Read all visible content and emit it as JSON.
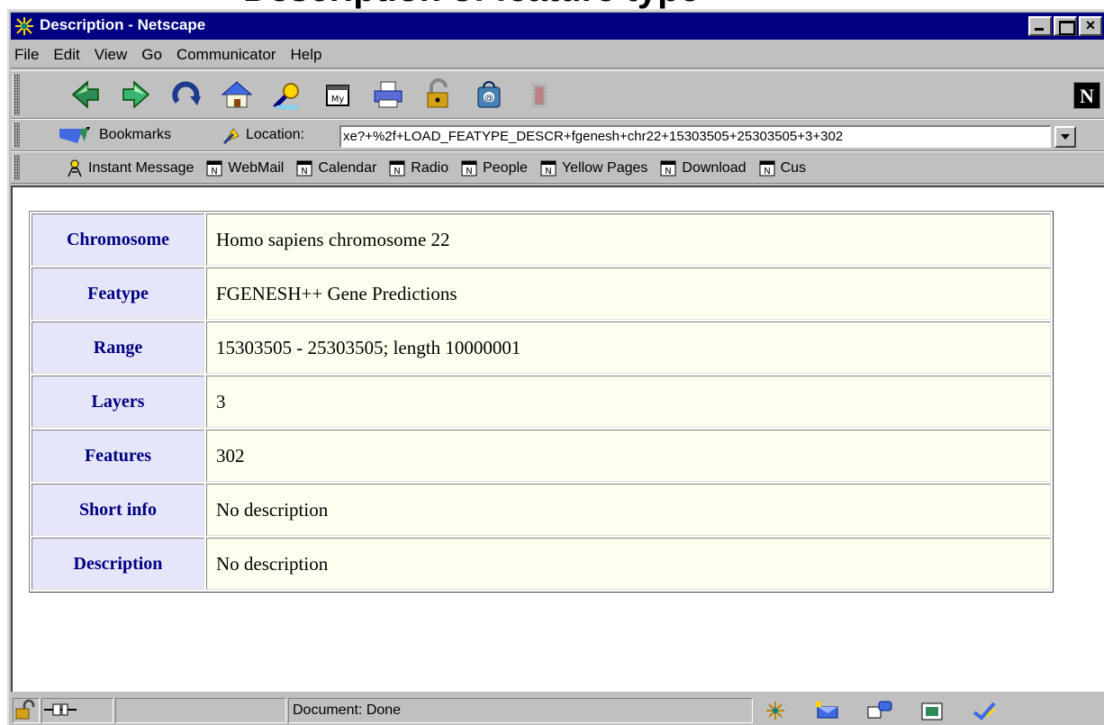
{
  "slide": {
    "heading_fragment": "Description of feature type"
  },
  "window": {
    "title": "Description - Netscape",
    "controls": {
      "minimize": "_",
      "maximize": "□",
      "close": "×"
    }
  },
  "menu": [
    "File",
    "Edit",
    "View",
    "Go",
    "Communicator",
    "Help"
  ],
  "navigation_icons": [
    "back-icon",
    "forward-icon",
    "reload-icon",
    "home-icon",
    "search-icon",
    "my-netscape-icon",
    "print-icon",
    "security-icon",
    "shop-icon",
    "stop-icon"
  ],
  "netscape_logo": "N",
  "location_bar": {
    "bookmarks_label": "Bookmarks",
    "location_label": "Location:",
    "url": "xe?+%2f+LOAD_FEATYPE_DESCR+fgenesh+chr22+15303505+25303505+3+302"
  },
  "personal_toolbar": [
    "Instant Message",
    "WebMail",
    "Calendar",
    "Radio",
    "People",
    "Yellow Pages",
    "Download",
    "Cus"
  ],
  "description_table": {
    "rows": [
      {
        "label": "Chromosome",
        "value": "Homo sapiens chromosome 22"
      },
      {
        "label": "Featype",
        "value": "FGENESH++ Gene Predictions"
      },
      {
        "label": "Range",
        "value": "15303505 - 25303505; length 10000001"
      },
      {
        "label": "Layers",
        "value": "3"
      },
      {
        "label": "Features",
        "value": "302"
      },
      {
        "label": "Short info",
        "value": "No description"
      },
      {
        "label": "Description",
        "value": "No description"
      }
    ]
  },
  "status_bar": {
    "status_text": "Document: Done",
    "icons": [
      "navigator-icon",
      "mail-icon",
      "discussion-icon",
      "composer-icon",
      "checkmark-icon"
    ]
  }
}
